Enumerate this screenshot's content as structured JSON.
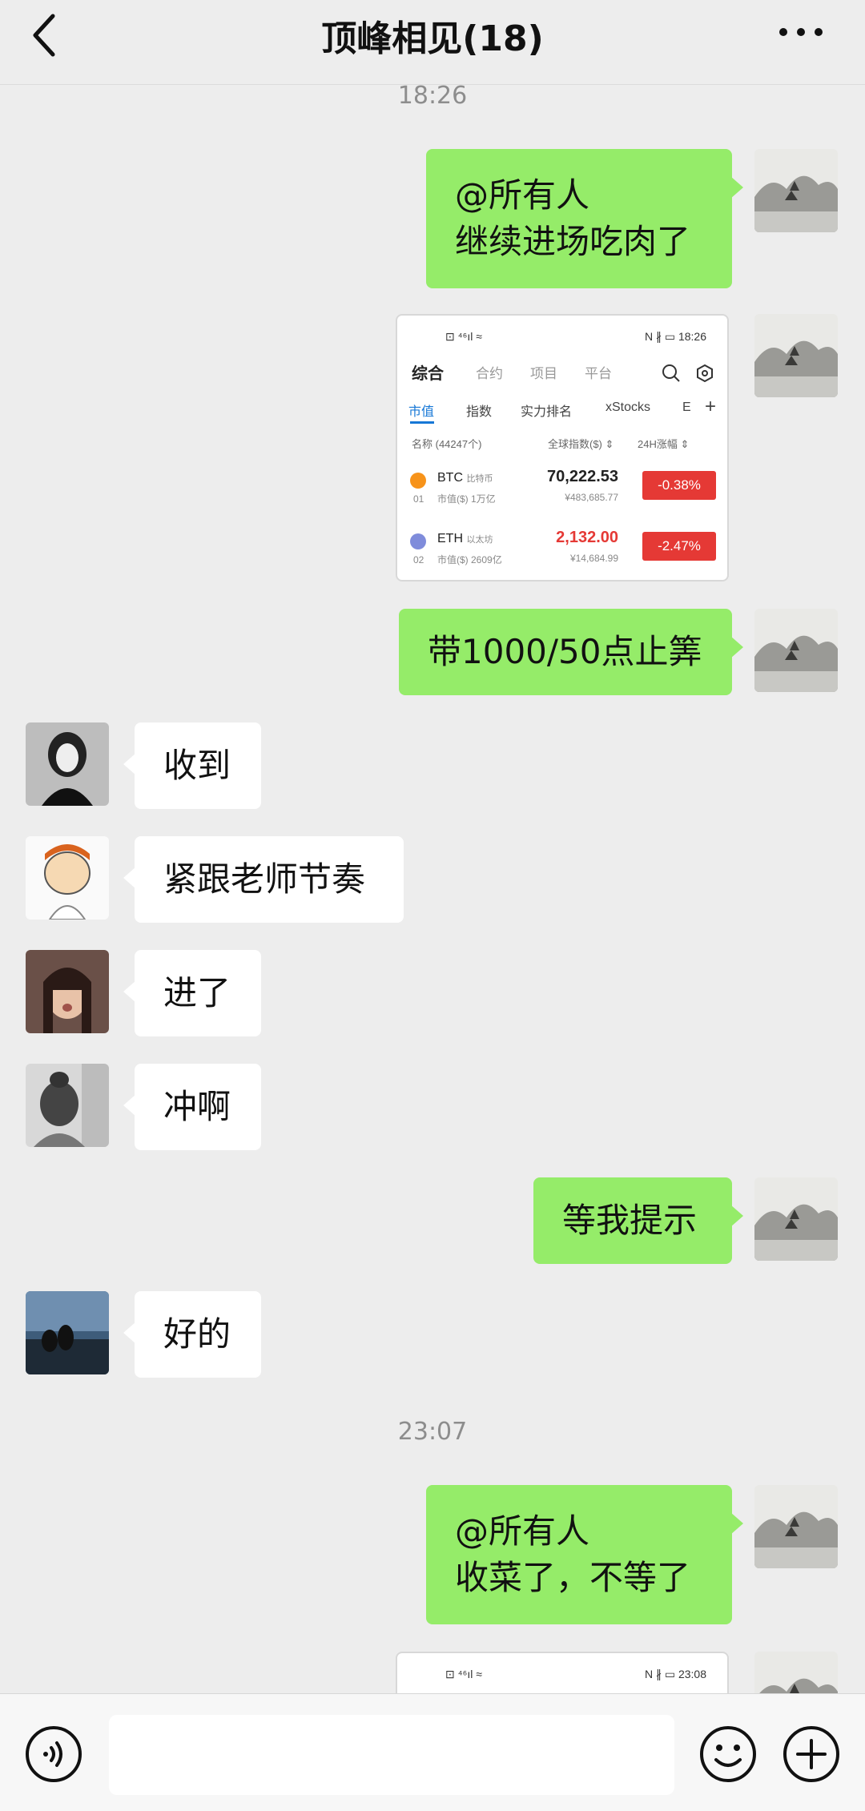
{
  "header": {
    "title": "顶峰相见(18)"
  },
  "timestamps": [
    "18:26",
    "23:07"
  ],
  "messages": {
    "m1": [
      "@所有人",
      "继续进场吃肉了"
    ],
    "m3": "带1000/50点止筭",
    "m4": "收到",
    "m5": "紧跟老师节奏",
    "m6": "进了",
    "m7": "冲啊",
    "m8": "等我提示",
    "m9": "好的",
    "m10": [
      "@所有人",
      "收菜了，不等了"
    ]
  },
  "screenshot1": {
    "status_left": "⊡ ⁴⁶ıl ≈",
    "status_right": "N ∦ ▭ 18:26",
    "tabs_top": [
      "综合",
      "合约",
      "项目",
      "平台"
    ],
    "tabs_sub": [
      "市值",
      "指数",
      "实力排名",
      "xStocks",
      "E"
    ],
    "header": {
      "name": "名称 (44247个)",
      "price": "全球指数($) ⇕",
      "change": "24H涨幅 ⇕"
    },
    "rows": [
      {
        "index": "01",
        "symbol": "BTC",
        "name": "比特币",
        "cap": "市值($) 1万亿",
        "price": "70,222.53",
        "cny": "¥483,685.77",
        "change": "-0.38%"
      },
      {
        "index": "02",
        "symbol": "ETH",
        "name": "以太坊",
        "cap": "市值($) 2609亿",
        "price": "2,132.00",
        "cny": "¥14,684.99",
        "change": "-2.47%"
      }
    ]
  },
  "screenshot2": {
    "status_left": "⊡ ⁴⁶ıl ≈",
    "status_right": "N ∦ ▭ 23:08"
  },
  "colors": {
    "own_bubble": "#95ec69",
    "other_bubble": "#ffffff",
    "background": "#ededed",
    "loss": "#e53935",
    "tab_accent": "#1677d6"
  },
  "icons": [
    "back-arrow-icon",
    "more-dots-icon",
    "voice-icon",
    "emoji-icon",
    "plus-icon",
    "search-icon",
    "settings-icon",
    "bitcoin-icon",
    "ethereum-icon"
  ]
}
